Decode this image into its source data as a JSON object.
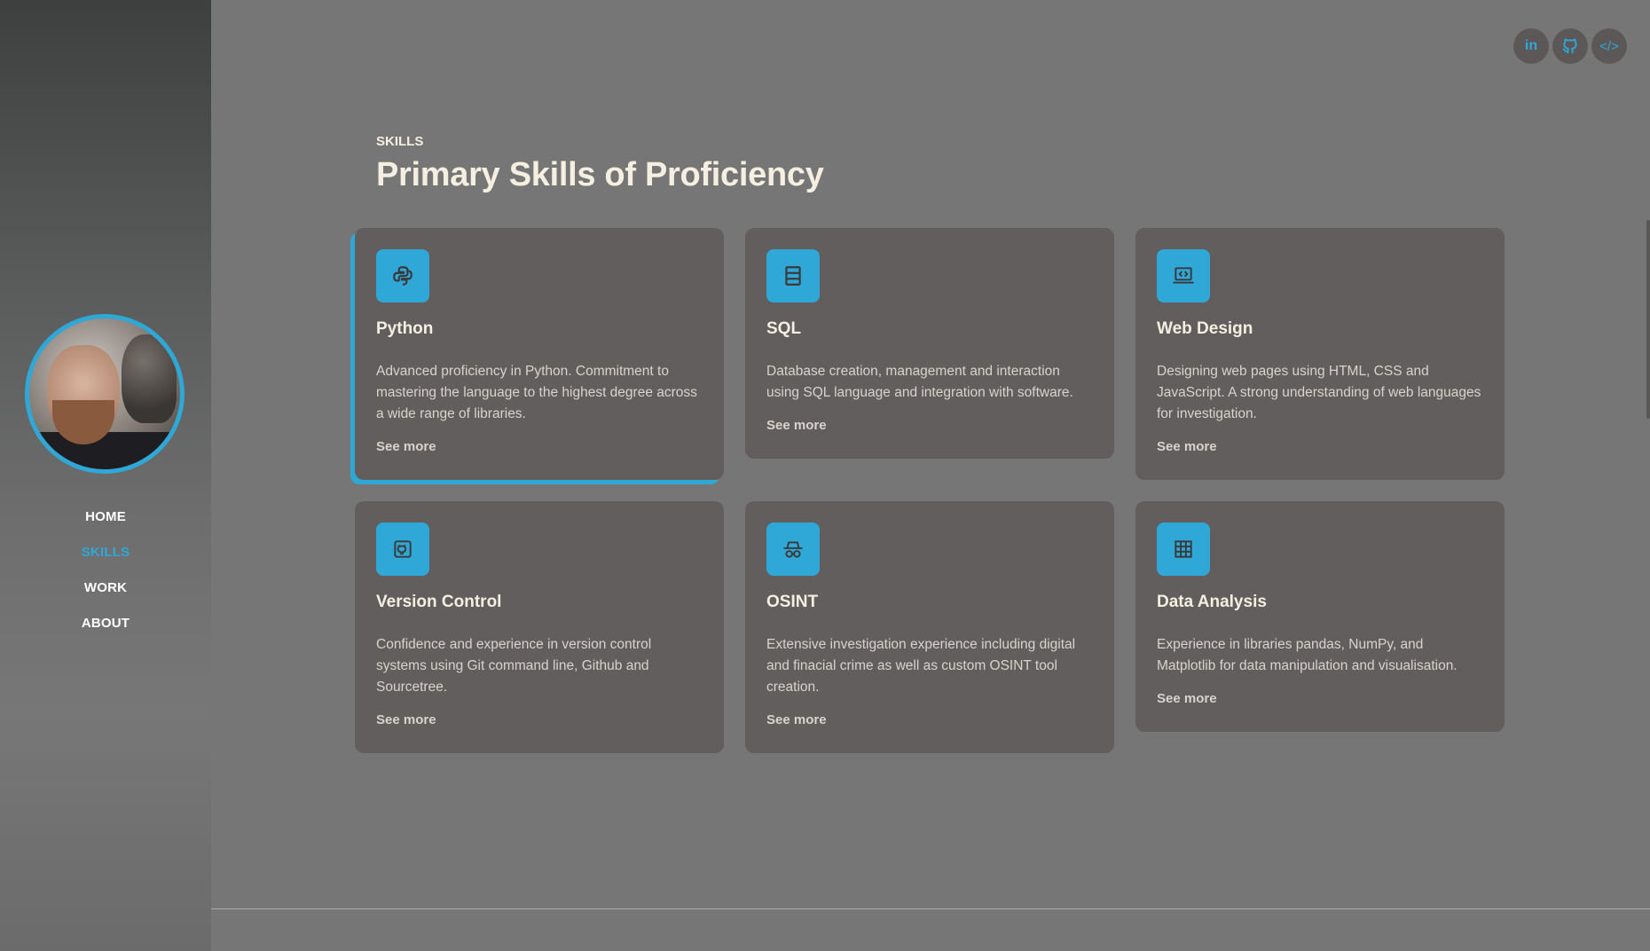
{
  "nav": {
    "items": [
      {
        "label": "HOME",
        "active": false
      },
      {
        "label": "SKILLS",
        "active": true
      },
      {
        "label": "WORK",
        "active": false
      },
      {
        "label": "ABOUT",
        "active": false
      }
    ]
  },
  "social": {
    "linkedin_label": "in",
    "github_icon": "github-icon",
    "code_label": "</>"
  },
  "section": {
    "eyebrow": "SKILLS",
    "title": "Primary Skills of Proficiency"
  },
  "cards": [
    {
      "icon": "python-icon",
      "title": "Python",
      "desc": "Advanced proficiency in Python. Commitment to mastering the language to the highest degree across a wide range of libraries.",
      "more": "See more"
    },
    {
      "icon": "database-icon",
      "title": "SQL",
      "desc": "Database creation, management and interaction using SQL language and integration with software.",
      "more": "See more"
    },
    {
      "icon": "laptop-code-icon",
      "title": "Web Design",
      "desc": "Designing web pages using HTML, CSS and JavaScript. A strong understanding of web languages for investigation.",
      "more": "See more"
    },
    {
      "icon": "github-icon",
      "title": "Version Control",
      "desc": "Confidence and experience in version control systems using Git command line, Github and Sourcetree.",
      "more": "See more"
    },
    {
      "icon": "spy-icon",
      "title": "OSINT",
      "desc": "Extensive investigation experience including digital and finacial crime as well as custom OSINT tool creation.",
      "more": "See more"
    },
    {
      "icon": "table-icon",
      "title": "Data Analysis",
      "desc": "Experience in libraries pandas, NumPy, and Matplotlib for data manipulation and visualisation.",
      "more": "See more"
    }
  ],
  "colors": {
    "accent": "#2fa8d8",
    "card_bg": "#625e5d",
    "page_bg": "#767676",
    "heading": "#f4efe1"
  }
}
